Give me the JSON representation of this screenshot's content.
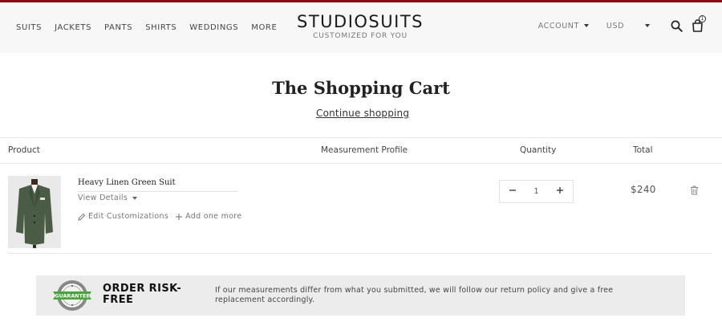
{
  "nav": {
    "items": [
      "SUITS",
      "JACKETS",
      "PANTS",
      "SHIRTS",
      "WEDDINGS",
      "MORE"
    ]
  },
  "logo": {
    "title": "STUDIOSUITS",
    "subtitle": "CUSTOMIZED FOR YOU"
  },
  "header": {
    "account_label": "ACCOUNT",
    "currency_label": "USD",
    "cart_count": "1",
    "icons": [
      "search-icon",
      "cart-bag-icon"
    ]
  },
  "page": {
    "title": "The Shopping Cart",
    "continue_label": "Continue shopping"
  },
  "table": {
    "headers": {
      "product": "Product",
      "measurement": "Measurement Profile",
      "quantity": "Quantity",
      "total": "Total"
    },
    "items": [
      {
        "name": "Heavy Linen Green Suit",
        "view_details": "View Details",
        "edit_label": "Edit Customizations",
        "add_label": "Add one more",
        "quantity": "1",
        "total": "$240"
      }
    ]
  },
  "banner": {
    "title": "ORDER RISK-FREE",
    "text": "If our measurements differ from what you submitted, we will follow our return policy and give a free replacement accordingly.",
    "seal_text": "GUARANTEE"
  },
  "colors": {
    "topbar": "#8b0d14",
    "header_bg": "#f7f7f7",
    "suit_green": "#4a5c45",
    "seal_green": "#43a935"
  }
}
